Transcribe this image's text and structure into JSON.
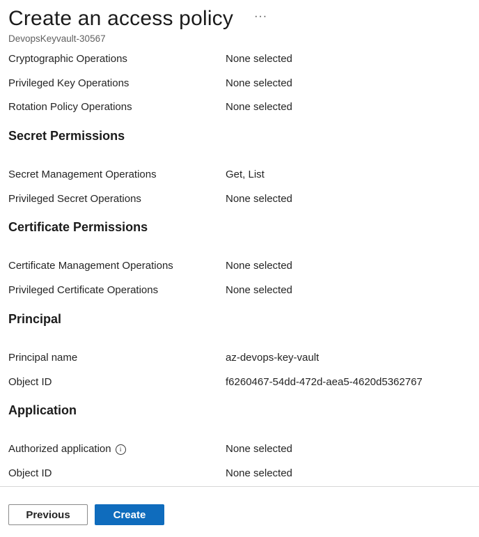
{
  "header": {
    "title": "Create an access policy",
    "more_label": "···",
    "subtitle": "DevopsKeyvault-30567"
  },
  "key_permissions_rows": [
    {
      "label": "Cryptographic Operations",
      "value": "None selected"
    },
    {
      "label": "Privileged Key Operations",
      "value": "None selected"
    },
    {
      "label": "Rotation Policy Operations",
      "value": "None selected"
    }
  ],
  "secret_permissions": {
    "title": "Secret Permissions",
    "rows": [
      {
        "label": "Secret Management Operations",
        "value": "Get, List"
      },
      {
        "label": "Privileged Secret Operations",
        "value": "None selected"
      }
    ]
  },
  "certificate_permissions": {
    "title": "Certificate Permissions",
    "rows": [
      {
        "label": "Certificate Management Operations",
        "value": "None selected"
      },
      {
        "label": "Privileged Certificate Operations",
        "value": "None selected"
      }
    ]
  },
  "principal": {
    "title": "Principal",
    "rows": [
      {
        "label": "Principal name",
        "value": "az-devops-key-vault"
      },
      {
        "label": "Object ID",
        "value": "f6260467-54dd-472d-aea5-4620d5362767"
      }
    ]
  },
  "application": {
    "title": "Application",
    "rows": [
      {
        "label": "Authorized application",
        "value": "None selected",
        "info_icon": "info-icon"
      },
      {
        "label": "Object ID",
        "value": "None selected"
      }
    ]
  },
  "footer": {
    "previous_label": "Previous",
    "create_label": "Create"
  },
  "colors": {
    "primary_button": "#0f6cbd",
    "text": "#242424"
  }
}
